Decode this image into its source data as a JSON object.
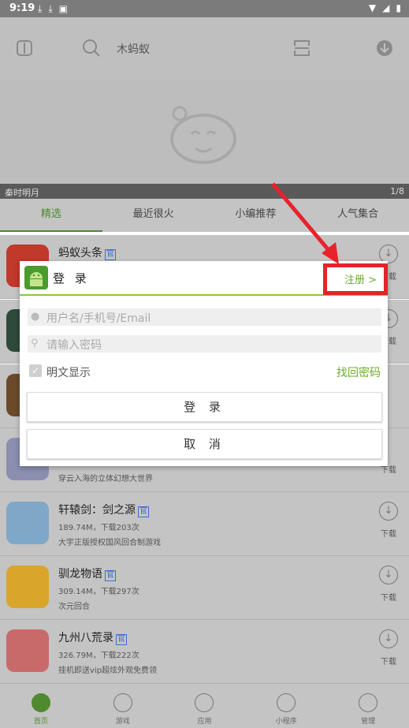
{
  "status": {
    "time": "9:19",
    "left_icons": [
      "download-icon",
      "download-icon",
      "a-icon"
    ],
    "right_icons": [
      "wifi-icon",
      "signal-icon",
      "battery-icon"
    ]
  },
  "search": {
    "placeholder": "木蚂蚁"
  },
  "banner": {
    "caption": "秦时明月",
    "page": "1/8"
  },
  "tabs": [
    {
      "label": "精选",
      "active": true
    },
    {
      "label": "最近很火"
    },
    {
      "label": "小编推荐"
    },
    {
      "label": "人气集合"
    }
  ],
  "apps": [
    {
      "title": "蚂蚁头条",
      "badge": "官",
      "meta": "",
      "desc": "",
      "download": "下载",
      "color": "#c0392b"
    },
    {
      "title": "",
      "badge": "",
      "meta": "",
      "desc": "",
      "download": "下载",
      "color": "#2e4a3a"
    },
    {
      "title": "",
      "badge": "",
      "meta": "",
      "desc": "",
      "download": "",
      "color": "#6b4a2a"
    },
    {
      "title": "",
      "badge": "",
      "meta": "",
      "desc": "穿云入海的立体幻想大世界",
      "download": "下载",
      "color": "#8a8fb0"
    },
    {
      "title": "轩辕剑：剑之源",
      "badge": "官",
      "meta": "189.74M，下载203次",
      "desc": "大宇正版授权国风回合制游戏",
      "download": "下载",
      "color": "#7fa7c8"
    },
    {
      "title": "驯龙物语",
      "badge": "官",
      "meta": "309.14M，下载297次",
      "desc": "次元回合",
      "download": "下载",
      "color": "#d9a52a"
    },
    {
      "title": "九州八荒录",
      "badge": "官",
      "meta": "326.79M，下载222次",
      "desc": "挂机即送vip超炫外观免费领",
      "download": "下载",
      "color": "#c96a6a"
    }
  ],
  "nav": [
    {
      "label": "首页",
      "active": true
    },
    {
      "label": "游戏"
    },
    {
      "label": "应用"
    },
    {
      "label": "小程序"
    },
    {
      "label": "管理"
    }
  ],
  "dialog": {
    "title": "登 录",
    "register": "注册 >",
    "username_placeholder": "用户名/手机号/Email",
    "password_placeholder": "请输入密码",
    "show_password_label": "明文显示",
    "forgot_label": "找回密码",
    "login_button": "登 录",
    "cancel_button": "取 消"
  },
  "colors": {
    "accent": "#8cc63f",
    "link": "#6bab2c",
    "annotation": "#e8212b"
  }
}
